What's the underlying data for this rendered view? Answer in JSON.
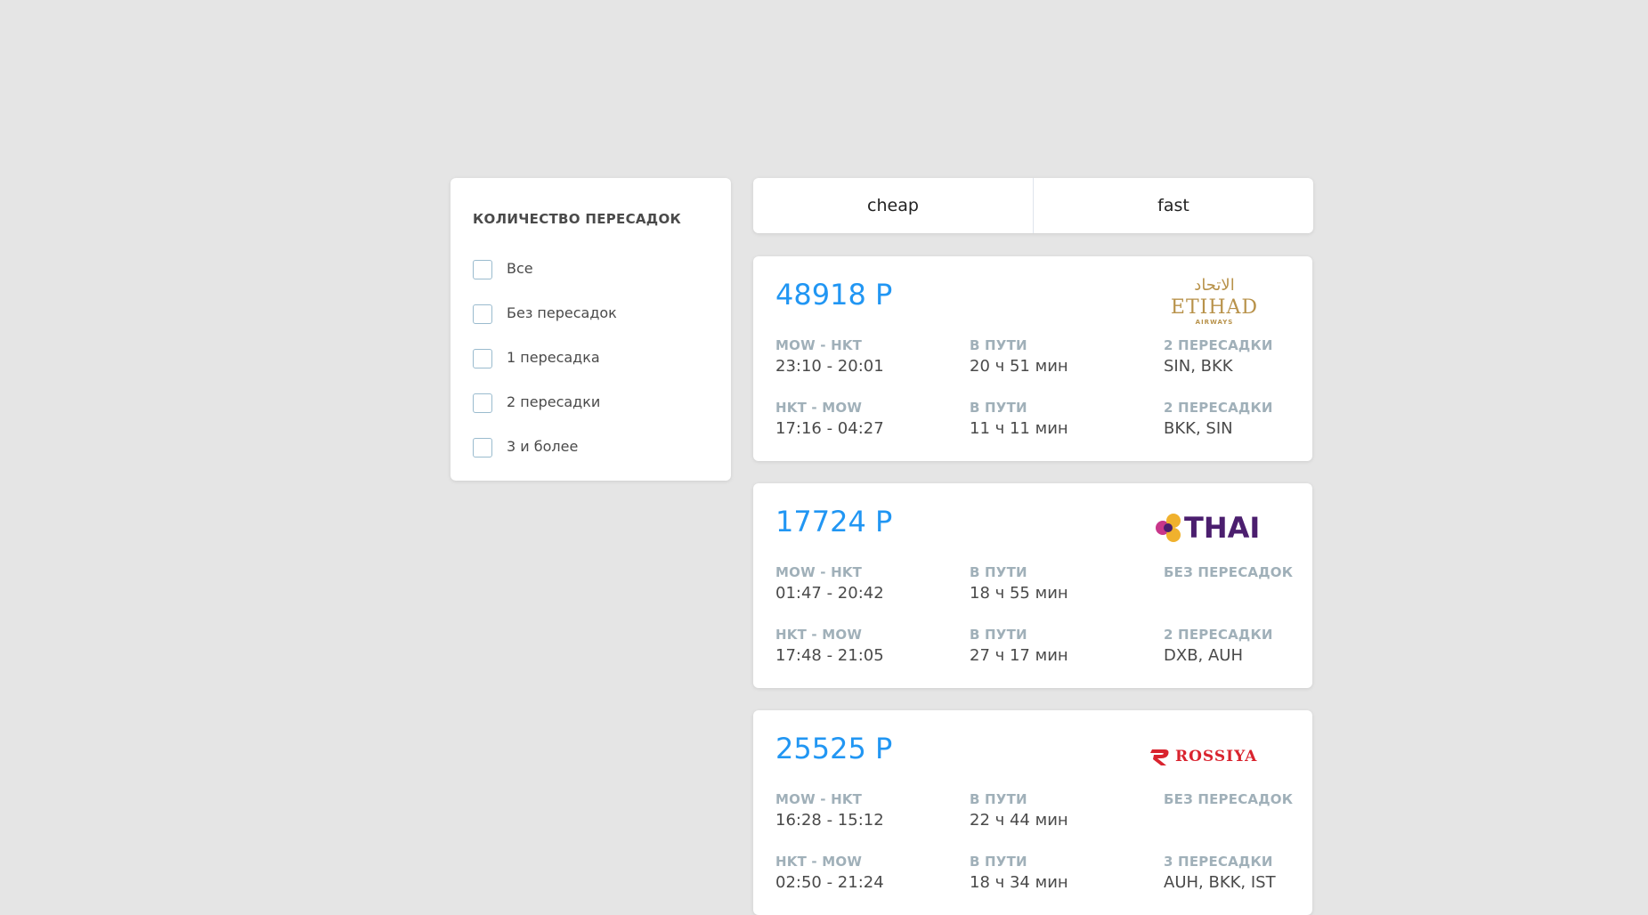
{
  "filter": {
    "title": "КОЛИЧЕСТВО ПЕРЕСАДОК",
    "options": [
      {
        "label": "Все",
        "checked": false
      },
      {
        "label": "Без пересадок",
        "checked": false
      },
      {
        "label": "1 пересадка",
        "checked": false
      },
      {
        "label": "2 пересадки",
        "checked": false
      },
      {
        "label": "3 и более",
        "checked": false
      }
    ]
  },
  "tabs": [
    {
      "label": "cheap"
    },
    {
      "label": "fast"
    }
  ],
  "colors": {
    "accent": "#2196f3",
    "label_gray": "#a0b0b9",
    "text": "#4a4a4a",
    "background": "#e5e5e5",
    "etihad_gold": "#b8924a",
    "thai_purple": "#4b1e6e",
    "rossiya_red": "#d9232e"
  },
  "tickets": [
    {
      "price": "48918 Р",
      "carrier": {
        "icon": "etihad-logo",
        "name": "ETIHAD",
        "sub": "AIRWAYS",
        "arabic": "الاتحاد"
      },
      "segments": [
        {
          "route": "MOW - HKT",
          "time": "23:10 - 20:01",
          "duration_label": "В ПУТИ",
          "duration": "20 ч 51 мин",
          "stops_label": "2 ПЕРЕСАДКИ",
          "stops": "SIN, BKK"
        },
        {
          "route": "HKT - MOW",
          "time": "17:16 - 04:27",
          "duration_label": "В ПУТИ",
          "duration": "11 ч 11 мин",
          "stops_label": "2 ПЕРЕСАДКИ",
          "stops": "BKK, SIN"
        }
      ]
    },
    {
      "price": "17724 Р",
      "carrier": {
        "icon": "thai-logo",
        "name": "THAI"
      },
      "segments": [
        {
          "route": "MOW - HKT",
          "time": "01:47 - 20:42",
          "duration_label": "В ПУТИ",
          "duration": "18 ч 55 мин",
          "stops_label": "БЕЗ ПЕРЕСАДОК",
          "stops": ""
        },
        {
          "route": "HKT - MOW",
          "time": "17:48 - 21:05",
          "duration_label": "В ПУТИ",
          "duration": "27 ч 17 мин",
          "stops_label": "2 ПЕРЕСАДКИ",
          "stops": "DXB, AUH"
        }
      ]
    },
    {
      "price": "25525 Р",
      "carrier": {
        "icon": "rossiya-logo",
        "name": "ROSSIYA"
      },
      "segments": [
        {
          "route": "MOW - HKT",
          "time": "16:28 - 15:12",
          "duration_label": "В ПУТИ",
          "duration": "22 ч 44 мин",
          "stops_label": "БЕЗ ПЕРЕСАДОК",
          "stops": ""
        },
        {
          "route": "HKT - MOW",
          "time": "02:50 - 21:24",
          "duration_label": "В ПУТИ",
          "duration": "18 ч 34 мин",
          "stops_label": "3 ПЕРЕСАДКИ",
          "stops": "AUH, BKK, IST"
        }
      ]
    }
  ]
}
